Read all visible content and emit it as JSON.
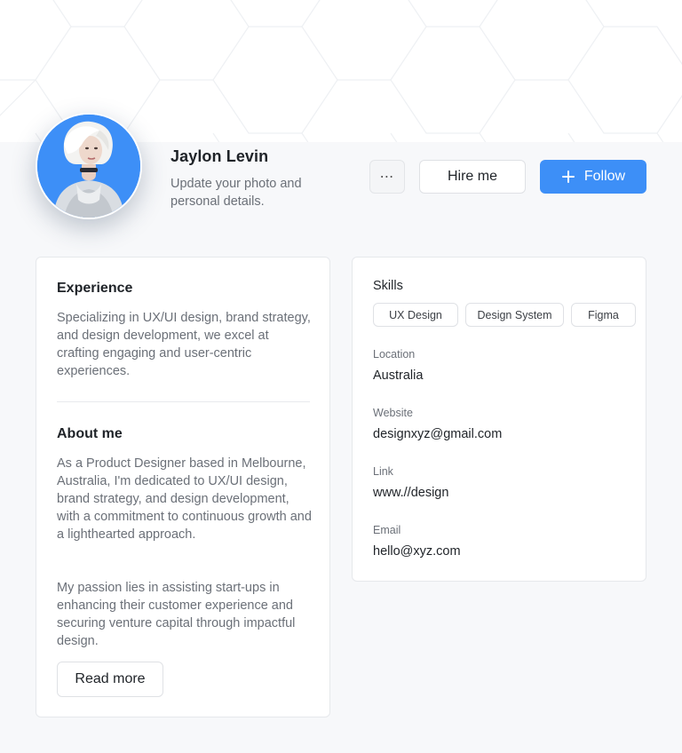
{
  "profile": {
    "name": "Jaylon Levin",
    "subtitle": "Update your photo and personal details."
  },
  "actions": {
    "more_label": "⋯",
    "hire_label": "Hire me",
    "follow_icon": "plus-icon",
    "follow_label": "Follow"
  },
  "experience": {
    "title": "Experience",
    "text": "Specializing in UX/UI design, brand strategy, and design development, we excel at crafting engaging and user-centric experiences."
  },
  "about": {
    "title": "About me",
    "paragraph1": "As a Product Designer based in Melbourne, Australia, I'm dedicated to UX/UI design, brand strategy, and design development, with a commitment to continuous growth and a lighthearted approach.",
    "paragraph2": "My passion lies in assisting start-ups in enhancing their customer experience and securing venture capital through impactful design.",
    "read_more_label": "Read more"
  },
  "details": {
    "skills_title": "Skills",
    "skills": [
      "UX Design",
      "Design System",
      "Figma"
    ],
    "location_label": "Location",
    "location_value": "Australia",
    "website_label": "Website",
    "website_value": "designxyz@gmail.com",
    "link_label": "Link",
    "link_value": "www.//design",
    "email_label": "Email",
    "email_value": "hello@xyz.com"
  },
  "colors": {
    "accent": "#3d8ff7",
    "background": "#f7f8fa",
    "card": "#ffffff",
    "muted_text": "#6b7078"
  }
}
